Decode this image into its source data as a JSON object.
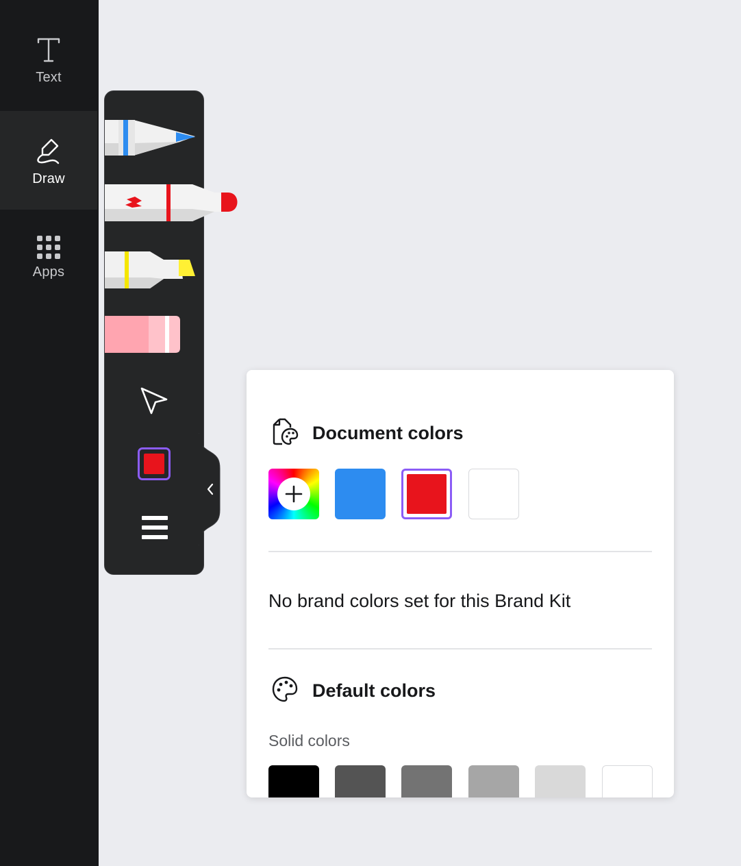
{
  "sidebar": {
    "items": [
      {
        "label": "Text",
        "icon": "text-icon"
      },
      {
        "label": "Draw",
        "icon": "draw-icon",
        "active": true
      },
      {
        "label": "Apps",
        "icon": "apps-grid-icon"
      }
    ]
  },
  "draw_tools": {
    "tools": [
      {
        "name": "pen",
        "color": "#2d8cf0"
      },
      {
        "name": "marker",
        "color": "#e8141c"
      },
      {
        "name": "highlighter",
        "color": "#fff034"
      },
      {
        "name": "eraser",
        "color": "#ffa5b0"
      },
      {
        "name": "select",
        "icon": "cursor-arrow-icon"
      }
    ],
    "current_color": "#e8141c",
    "menu_icon": "hamburger-menu-icon",
    "collapse_icon": "chevron-left-icon"
  },
  "color_panel": {
    "document_colors": {
      "title": "Document colors",
      "icon": "document-palette-icon",
      "add_icon": "plus-icon",
      "swatches": [
        "#2d8cf0",
        "#e8141c",
        "#ffffff"
      ],
      "selected": "#e8141c"
    },
    "brand_message": "No brand colors set for this Brand Kit",
    "default_colors": {
      "title": "Default colors",
      "icon": "palette-icon",
      "solid_label": "Solid colors",
      "swatches": [
        "#000000",
        "#545454",
        "#737373",
        "#a6a6a6",
        "#d9d9d9",
        "#ffffff"
      ]
    },
    "accent": "#8b5cf6"
  }
}
